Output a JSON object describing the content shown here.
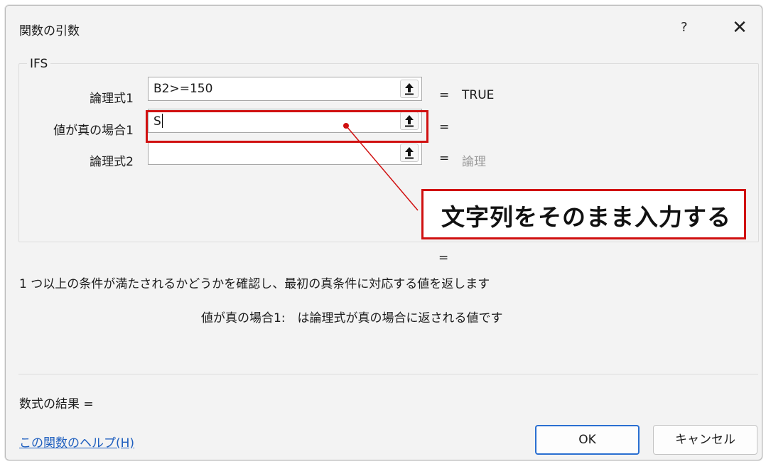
{
  "dialog": {
    "title": "関数の引数",
    "help_label": "?",
    "close_label": "✕"
  },
  "function_group": {
    "name": "IFS",
    "args": [
      {
        "label": "論理式1",
        "value": "B2>=150",
        "equals": "=",
        "result": "TRUE"
      },
      {
        "label": "値が真の場合1",
        "value": "S",
        "equals": "=",
        "result": ""
      },
      {
        "label": "論理式2",
        "value": "",
        "equals": "=",
        "result": "論理"
      }
    ]
  },
  "annotation": {
    "callout_text": "文字列をそのまま入力する",
    "color": "#d01010"
  },
  "formula_equals": "=",
  "description": "1 つ以上の条件が満たされるかどうかを確認し、最初の真条件に対応する値を返します",
  "arg_description": "値が真の場合1:　は論理式が真の場合に返される値です",
  "formula_result": "数式の結果 =",
  "help_link": "この関数のヘルプ(H)",
  "buttons": {
    "ok": "OK",
    "cancel": "キャンセル"
  },
  "colors": {
    "accent": "#2a6fd1",
    "link": "#1f5fbf",
    "dialog_bg": "#f3f3f3"
  }
}
